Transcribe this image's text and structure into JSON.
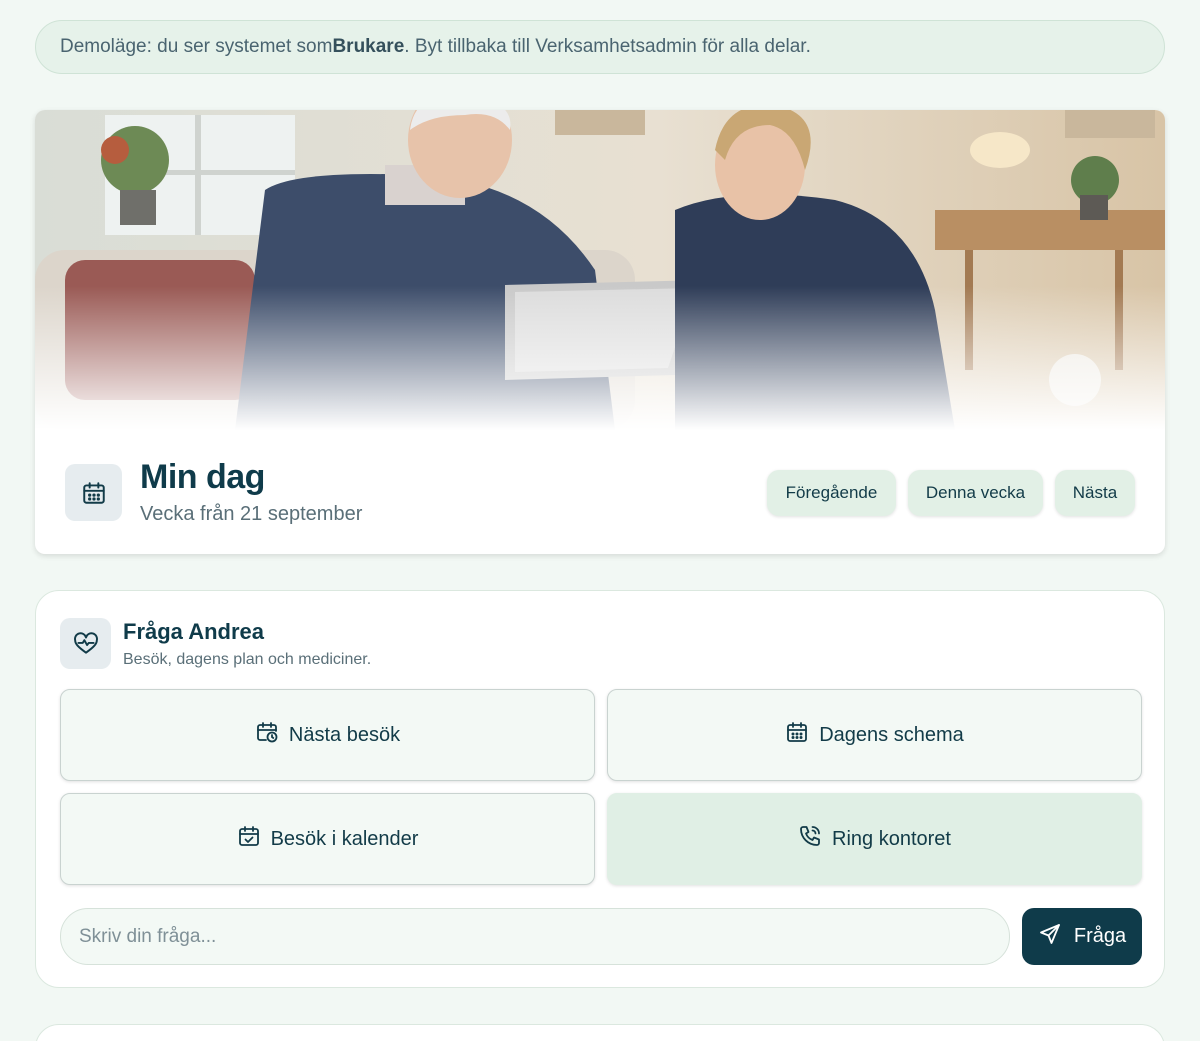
{
  "banner": {
    "prefix": "Demoläge: du ser systemet som ",
    "role": "Brukare",
    "suffix": ". Byt tillbaka till Verksamhetsadmin för alla delar."
  },
  "hero": {
    "image_description": "calendar-icon",
    "title": "Min dag",
    "subtitle": "Vecka från 21 september",
    "nav": {
      "previous": "Föregående",
      "this_week": "Denna vecka",
      "next": "Nästa"
    }
  },
  "ask": {
    "icon": "heart-pulse-icon",
    "title": "Fråga Andrea",
    "subtitle": "Besök, dagens plan och mediciner.",
    "quick_actions": [
      {
        "label": "Nästa besök",
        "icon": "calendar-clock-icon"
      },
      {
        "label": "Dagens schema",
        "icon": "calendar-icon"
      },
      {
        "label": "Besök i kalender",
        "icon": "calendar-check-icon"
      },
      {
        "label": "Ring kontoret",
        "icon": "phone-icon"
      }
    ],
    "input_placeholder": "Skriv din fråga...",
    "send_label": "Fråga"
  },
  "colors": {
    "background": "#f2f8f4",
    "primary": "#0f3b4a",
    "accent_soft": "#e2f0e6"
  }
}
